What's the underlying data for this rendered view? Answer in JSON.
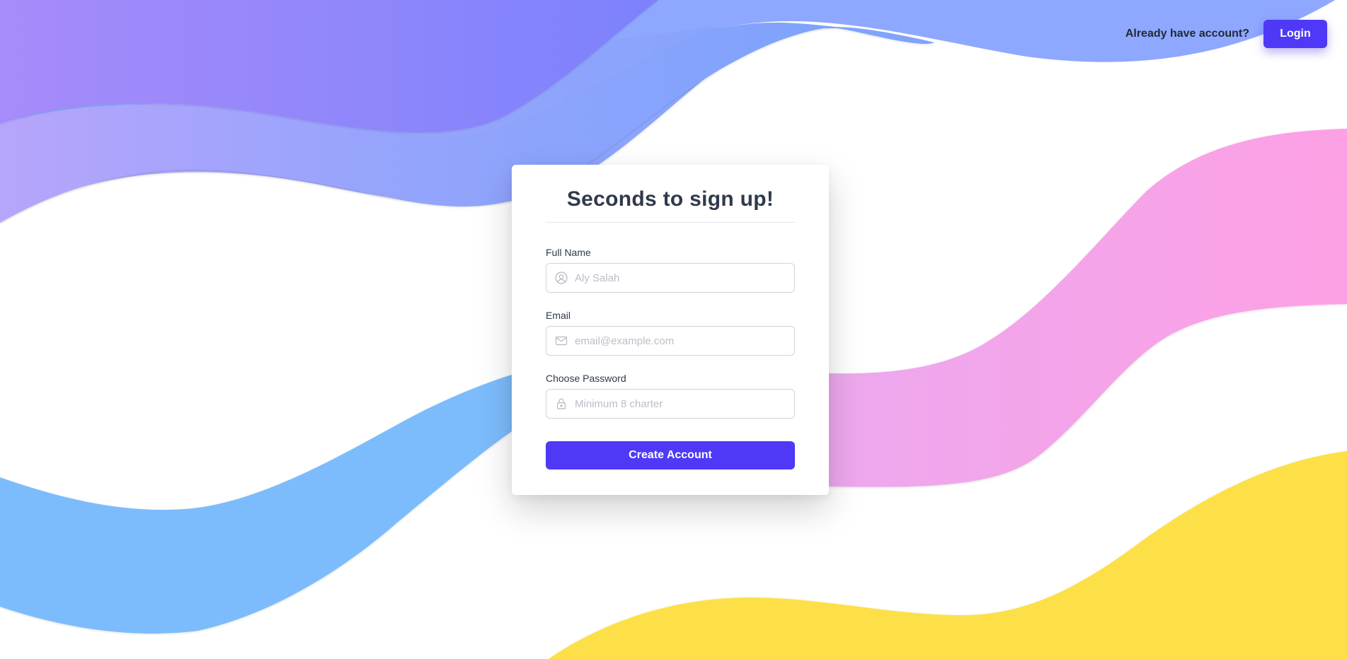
{
  "header": {
    "prompt": "Already have account?",
    "login_label": "Login"
  },
  "form": {
    "title": "Seconds to sign up!",
    "fields": [
      {
        "label": "Full Name",
        "placeholder": "Aly Salah",
        "value": "",
        "icon": "user-circle-icon"
      },
      {
        "label": "Email",
        "placeholder": "email@example.com",
        "value": "",
        "icon": "envelope-icon"
      },
      {
        "label": "Choose Password",
        "placeholder": "Minimum 8 charter",
        "value": "",
        "icon": "lock-icon"
      }
    ],
    "submit_label": "Create Account"
  },
  "colors": {
    "accent": "#4f39f6",
    "wave_purple": "#8b85ff",
    "wave_periwinkle": "#8fa8ff",
    "wave_pink": "#fca0e6",
    "wave_blue": "#7cbcfc",
    "wave_yellow": "#fde047"
  }
}
